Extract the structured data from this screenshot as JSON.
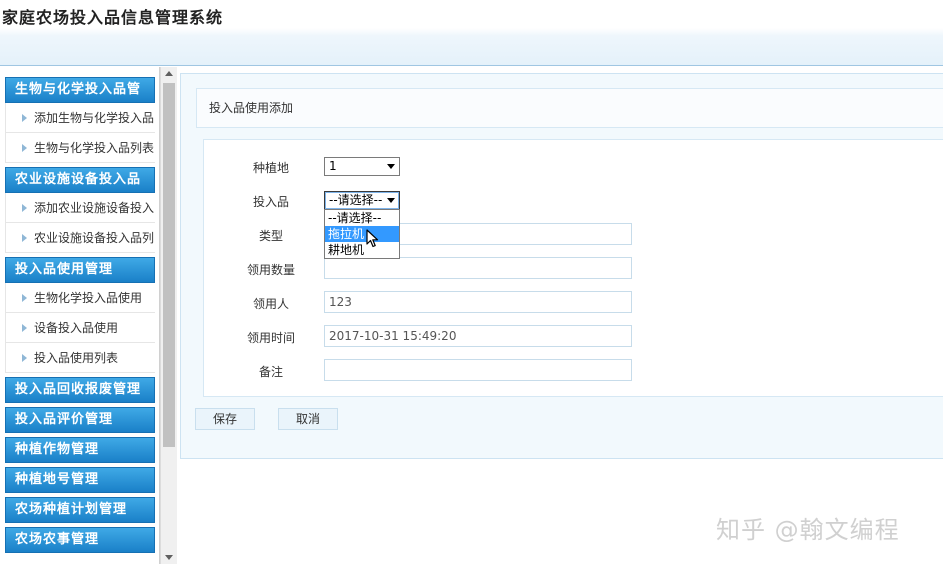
{
  "app": {
    "title": "家庭农场投入品信息管理系统"
  },
  "sidebar": {
    "groups": [
      {
        "label": "生物与化学投入品管",
        "items": [
          "添加生物与化学投入品",
          "生物与化学投入品列表"
        ]
      },
      {
        "label": "农业设施设备投入品",
        "items": [
          "添加农业设施设备投入",
          "农业设施设备投入品列"
        ]
      },
      {
        "label": "投入品使用管理",
        "items": [
          "生物化学投入品使用",
          "设备投入品使用",
          "投入品使用列表"
        ]
      },
      {
        "label": "投入品回收报废管理",
        "items": []
      },
      {
        "label": "投入品评价管理",
        "items": []
      },
      {
        "label": "种植作物管理",
        "items": []
      },
      {
        "label": "种植地号管理",
        "items": []
      },
      {
        "label": "农场种植计划管理",
        "items": []
      },
      {
        "label": "农场农事管理",
        "items": []
      }
    ]
  },
  "main": {
    "section_title": "投入品使用添加",
    "form": {
      "plot_label": "种植地",
      "plot_value": "1",
      "input_item_label": "投入品",
      "input_item_value": "--请选择--",
      "input_item_options": [
        "--请选择--",
        "拖拉机",
        "耕地机"
      ],
      "highlighted_option": "拖拉机",
      "type_label": "类型",
      "type_value": "",
      "quantity_label": "领用数量",
      "quantity_value": "",
      "recipient_label": "领用人",
      "recipient_value": "123",
      "time_label": "领用时间",
      "time_value": "2017-10-31 15:49:20",
      "note_label": "备注",
      "note_value": ""
    },
    "buttons": {
      "save": "保存",
      "cancel": "取消"
    }
  },
  "watermark": "知乎 @翰文编程",
  "colors": {
    "sidebar_group": "#1a80c8",
    "highlight": "#3399ff",
    "panel_bg": "#f2f9fd"
  }
}
